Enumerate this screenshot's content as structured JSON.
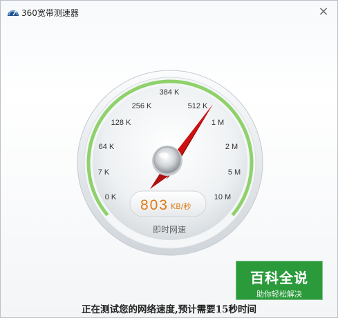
{
  "window": {
    "title": "360宽带测速器",
    "close_glyph": "×",
    "icons": {
      "app": "speed-meter-app-icon",
      "close": "close-icon"
    }
  },
  "gauge": {
    "tick_labels": [
      "0 K",
      "7 K",
      "64 K",
      "128 K",
      "256 K",
      "384 K",
      "512 K",
      "1 M",
      "2 M",
      "5 M",
      "10 M"
    ],
    "speed_value": "803",
    "speed_unit": "KB/秒",
    "caption": "即时网速",
    "needle_position_between": [
      "512 K",
      "1 M"
    ],
    "colors": {
      "progress_arc": "#8fd16b",
      "needle": "#cc1111",
      "speed_text": "#e07a12"
    }
  },
  "status": "正在测试您的网络速度,预计需要15秒时间",
  "watermark": {
    "main": "百科全说",
    "sub": "助你轻松解决",
    "color": "#2b9a3b"
  }
}
